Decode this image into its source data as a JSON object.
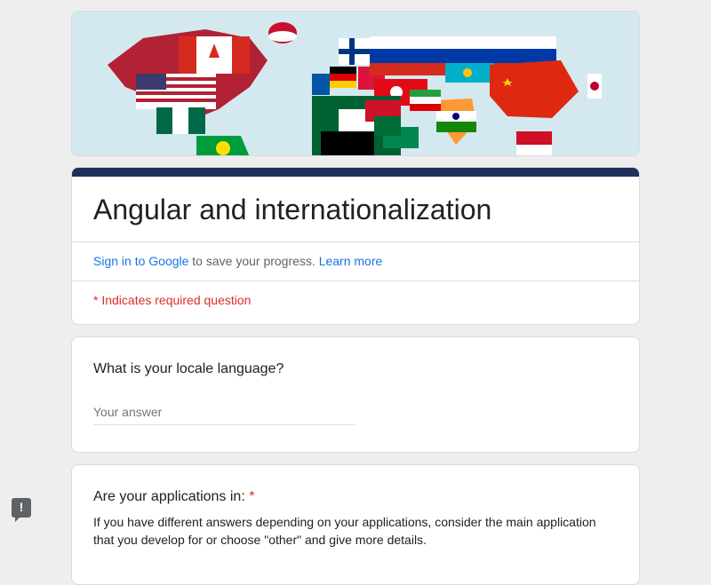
{
  "form": {
    "title": "Angular and internationalization",
    "signin_link": "Sign in to Google",
    "signin_rest": " to save your progress. ",
    "learn_more": "Learn more",
    "required_note": "* Indicates required question"
  },
  "questions": [
    {
      "title": "What is your locale language?",
      "placeholder": "Your answer"
    },
    {
      "title": "Are your applications in:",
      "required_star": "*",
      "description": "If you have different answers depending on your applications, consider the main application that you develop for or choose \"other\" and give more details."
    }
  ],
  "feedback": {
    "icon": "!"
  },
  "colors": {
    "accent": "#1f2f5b",
    "link": "#1a73e8",
    "required": "#d93025",
    "background": "#eeeeee"
  }
}
